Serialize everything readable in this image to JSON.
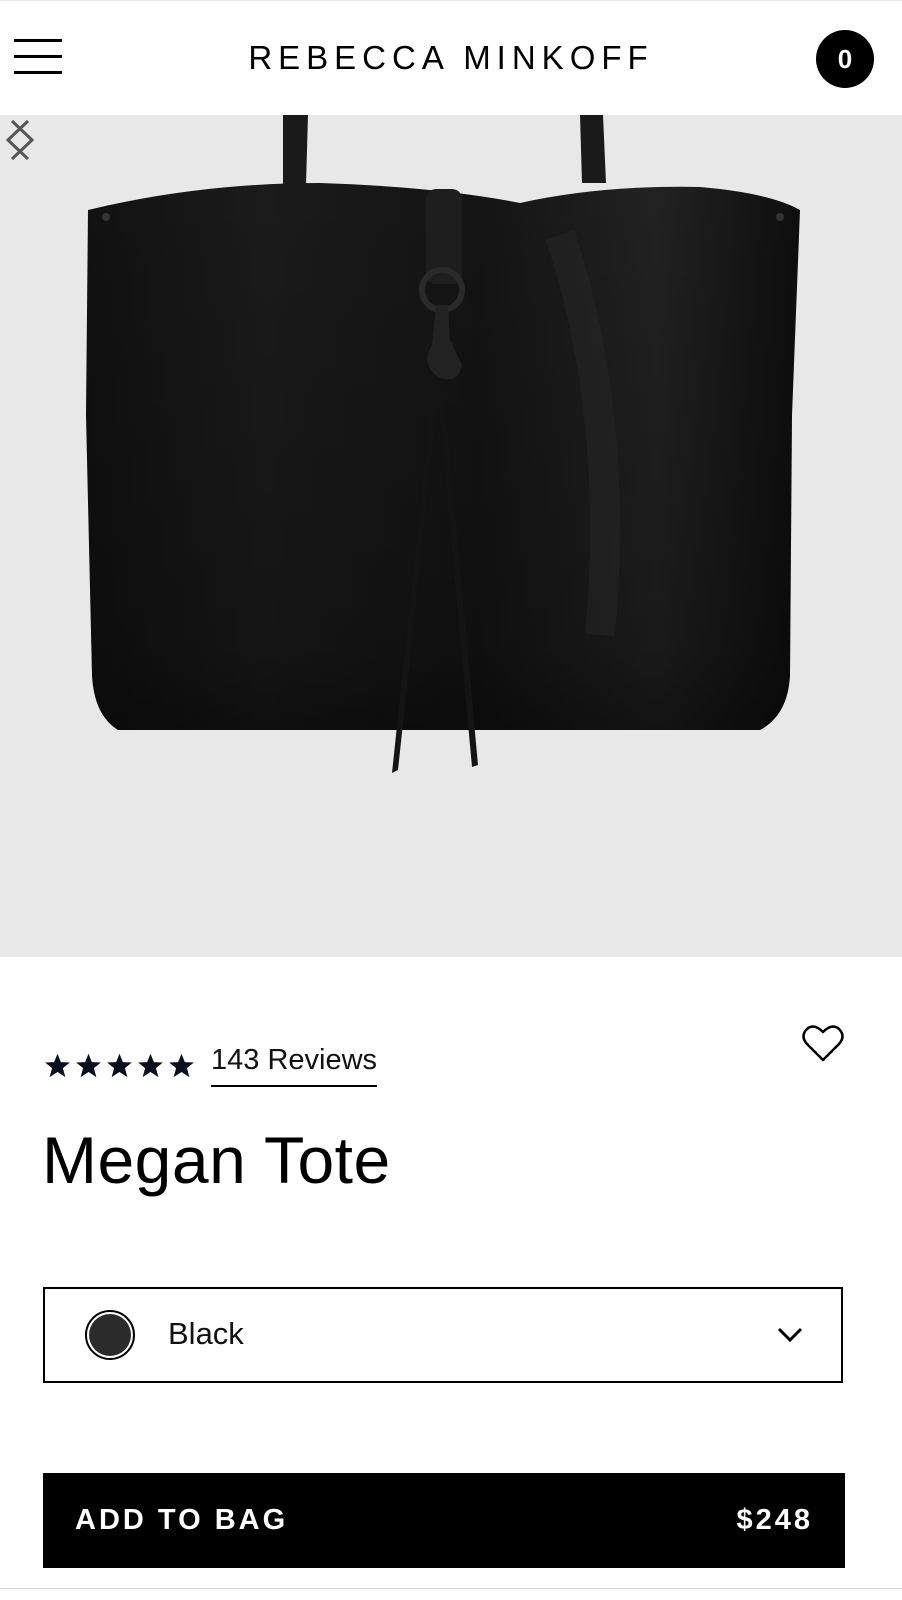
{
  "header": {
    "brand": "REBECCA MINKOFF",
    "cart_count": "0"
  },
  "product": {
    "rating": {
      "stars_filled": 5,
      "stars_total": 5
    },
    "reviews_label": "143 Reviews",
    "title": "Megan Tote",
    "color": {
      "selected": "Black",
      "swatch_color": "#2b2b2b"
    },
    "add_to_bag_label": "ADD TO BAG",
    "price": "$248"
  },
  "icons": {
    "menu": "hamburger-menu-icon",
    "cart": "cart-count-badge",
    "prev": "chevron-left-icon",
    "next": "chevron-right-icon",
    "star": "star-icon",
    "wishlist": "heart-icon",
    "dropdown": "chevron-down-icon"
  },
  "colors": {
    "gallery_background": "#e8e8e8",
    "primary": "#000000",
    "on_primary": "#ffffff"
  }
}
